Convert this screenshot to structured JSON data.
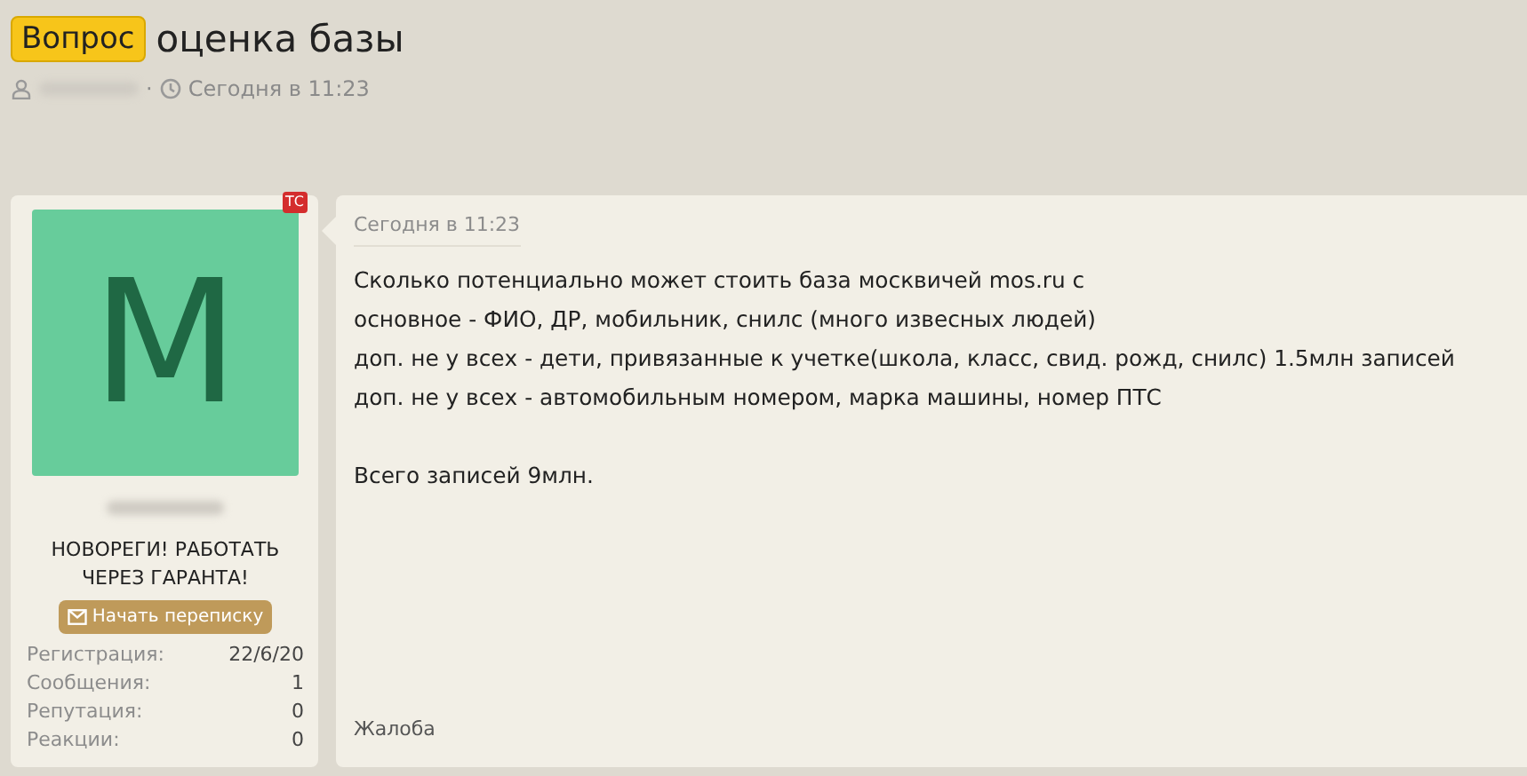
{
  "thread": {
    "prefix": "Вопрос",
    "title": "оценка базы",
    "separator": "·",
    "time": "Сегодня в 11:23"
  },
  "author": {
    "avatar_letter": "M",
    "starter_badge": "ТС",
    "user_title": "НОВОРЕГИ! РАБОТАТЬ ЧЕРЕЗ ГАРАНТА!",
    "message_button": "Начать переписку",
    "stats": [
      {
        "label": "Регистрация:",
        "value": "22/6/20"
      },
      {
        "label": "Сообщения:",
        "value": "1"
      },
      {
        "label": "Репутация:",
        "value": "0"
      },
      {
        "label": "Реакции:",
        "value": "0"
      }
    ]
  },
  "post": {
    "time": "Сегодня в 11:23",
    "paragraphs": [
      [
        "Сколько потенциально может стоить база москвичей mos.ru с",
        "основное - ФИО, ДР, мобильник, снилс (много извесных людей)",
        "доп. не у всех - дети, привязанные к учетке(школа, класс, свид. рожд, снилс) 1.5млн записей",
        "доп. не у всех - автомобильным номером, марка машины, номер ПТС"
      ],
      [
        "Всего записей 9млн."
      ]
    ],
    "report_link": "Жалоба"
  }
}
